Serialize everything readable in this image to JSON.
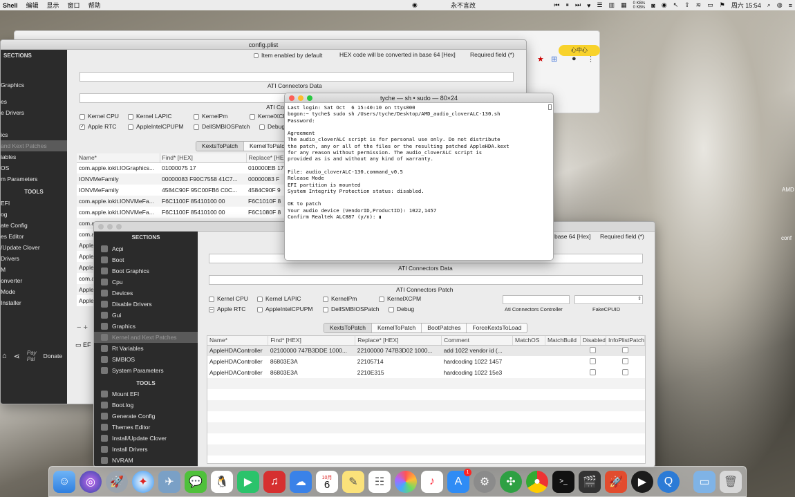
{
  "menubar": {
    "app": "Shell",
    "items": [
      "编辑",
      "显示",
      "窗口",
      "帮助"
    ],
    "now_playing": "永不言改",
    "net_up": "0 KB/s",
    "net_down": "0 KB/s",
    "clock": "周六 15:54"
  },
  "browser": {
    "yellow_button": "心中心"
  },
  "back_window": {
    "title": "config.plist",
    "legend_item": "Item enabled by default",
    "hex_note": "HEX code will be converted in base 64 [Hex]",
    "required": "Required field (*)",
    "ati_data_label": "ATI Connectors Data",
    "ati_patch_label": "ATI Co",
    "checks_row1": [
      "Kernel CPU",
      "Kernel LAPIC",
      "KernelPm",
      "KernelXCP"
    ],
    "checks_row2": [
      "Apple RTC",
      "AppleIntelCPUPM",
      "DellSMBIOSPatch",
      "Debug"
    ],
    "tabs": [
      "KextsToPatch",
      "KernelToPatc"
    ],
    "columns": [
      "Name*",
      "Find* [HEX]",
      "Replace* [HEX]"
    ],
    "rows": [
      [
        "com.apple.iokit.IOGraphics...",
        "01000075 17",
        "010000EB 17"
      ],
      [
        "IONVMeFamily",
        "00000083 F90C7558 41C7...",
        "00000083 F"
      ],
      [
        "IONVMeFamily",
        "4584C90F 95C00FB6 C0C...",
        "4584C90F 9"
      ],
      [
        "com.apple.iokit.IONVMeFa...",
        "F6C1100F 85410100 00",
        "F6C1010F 8"
      ],
      [
        "com.apple.iokit.IONVMeFa...",
        "F6C1100F 85410100 00",
        "F6C1080F 8"
      ],
      [
        "com.a",
        "",
        ""
      ],
      [
        "com.a",
        "",
        ""
      ],
      [
        "Apple",
        "",
        ""
      ],
      [
        "Apple",
        "",
        ""
      ],
      [
        "Apple",
        "",
        ""
      ],
      [
        "com.a",
        "",
        ""
      ],
      [
        "Apple",
        "",
        ""
      ],
      [
        "Apple",
        "",
        ""
      ]
    ],
    "sidebar": {
      "sections_head": "SECTIONS",
      "items": [
        "Graphics",
        "es",
        "e Drivers",
        "ics",
        "and Kext Patches",
        "iables",
        "OS",
        "m Parameters"
      ],
      "tools_head": "TOOLS",
      "tools": [
        "EFI",
        "og",
        "ate Config",
        "es Editor",
        "/Update Clover",
        "Drivers",
        "M",
        "onverter",
        "Mode",
        "Installer"
      ],
      "donate": "Donate",
      "share_icon": "share-icon",
      "home_icon": "home-icon"
    },
    "bottom_stub": "EF"
  },
  "terminal": {
    "title": "tyche — sh • sudo — 80×24",
    "lines": [
      "Last login: Sat Oct  6 15:40:10 on ttys000",
      "bogon:~ tyche$ sudo sh /Users/tyche/Desktop/AMD_audio_cloverALC-130.sh",
      "Password:",
      "",
      "Agreement",
      "The audio_cloverALC script is for personal use only. Do not distribute",
      "the patch, any or all of the files or the resulting patched AppleHDA.kext",
      "for any reason without permission. The audio_cloverALC script is",
      "provided as is and without any kind of warranty.",
      "",
      "File: audio_cloverALC-130.command_v0.5",
      "Release Mode",
      "EFI partition is mounted",
      "System Integrity Protection status: disabled.",
      "",
      "OK to patch",
      "Your audio device (VendorID,ProductID): 1022,1457",
      "Confirm Realtek ALC887 (y/n): "
    ]
  },
  "front_window": {
    "hex_note": "base 64 [Hex]",
    "required": "Required field (*)",
    "ati_data_label": "ATI Connectors Data",
    "ati_patch_label": "ATI Connectors Patch",
    "checks_row1": [
      "Kernel CPU",
      "Kernel LAPIC",
      "KernelPm",
      "KernelXCPM"
    ],
    "checks_row2": [
      "Apple RTC",
      "AppleIntelCPUPM",
      "DellSMBIOSPatch",
      "Debug"
    ],
    "ati_controller_label": "Ati Connectors Controller",
    "fake_cpuid_label": "FakeCPUID",
    "tabs": [
      "KextsToPatch",
      "KernelToPatch",
      "BootPatches",
      "ForceKextsToLoad"
    ],
    "columns": [
      "Name*",
      "Find* [HEX]",
      "Replace* [HEX]",
      "Comment",
      "MatchOS",
      "MatchBuild",
      "Disabled",
      "InfoPlistPatch"
    ],
    "rows": [
      [
        "AppleHDAController",
        "02100000 747B3DDE 1000...",
        "22100000 747B3D02 1000...",
        "add 1022 vendor id (..."
      ],
      [
        "AppleHDAController",
        "86803E3A",
        "22105714",
        "hardcoding 1022 1457"
      ],
      [
        "AppleHDAController",
        "86803E3A",
        "2210E315",
        "hardcoding 1022 15e3"
      ]
    ],
    "sidebar": {
      "sections_head": "SECTIONS",
      "items": [
        "Acpi",
        "Boot",
        "Boot Graphics",
        "Cpu",
        "Devices",
        "Disable Drivers",
        "Gui",
        "Graphics",
        "Kernel and Kext Patches",
        "Rt Variables",
        "SMBIOS",
        "System Parameters"
      ],
      "tools_head": "TOOLS",
      "tools": [
        "Mount EFI",
        "Boot.log",
        "Generate Config",
        "Themes Editor",
        "Install/Update Clover",
        "Install Drivers",
        "NVRAM"
      ]
    }
  },
  "right_edge_labels": [
    "AMD",
    "conf"
  ],
  "dock": {
    "badge": "1",
    "calendar_month": "10月",
    "calendar_day": "6"
  }
}
